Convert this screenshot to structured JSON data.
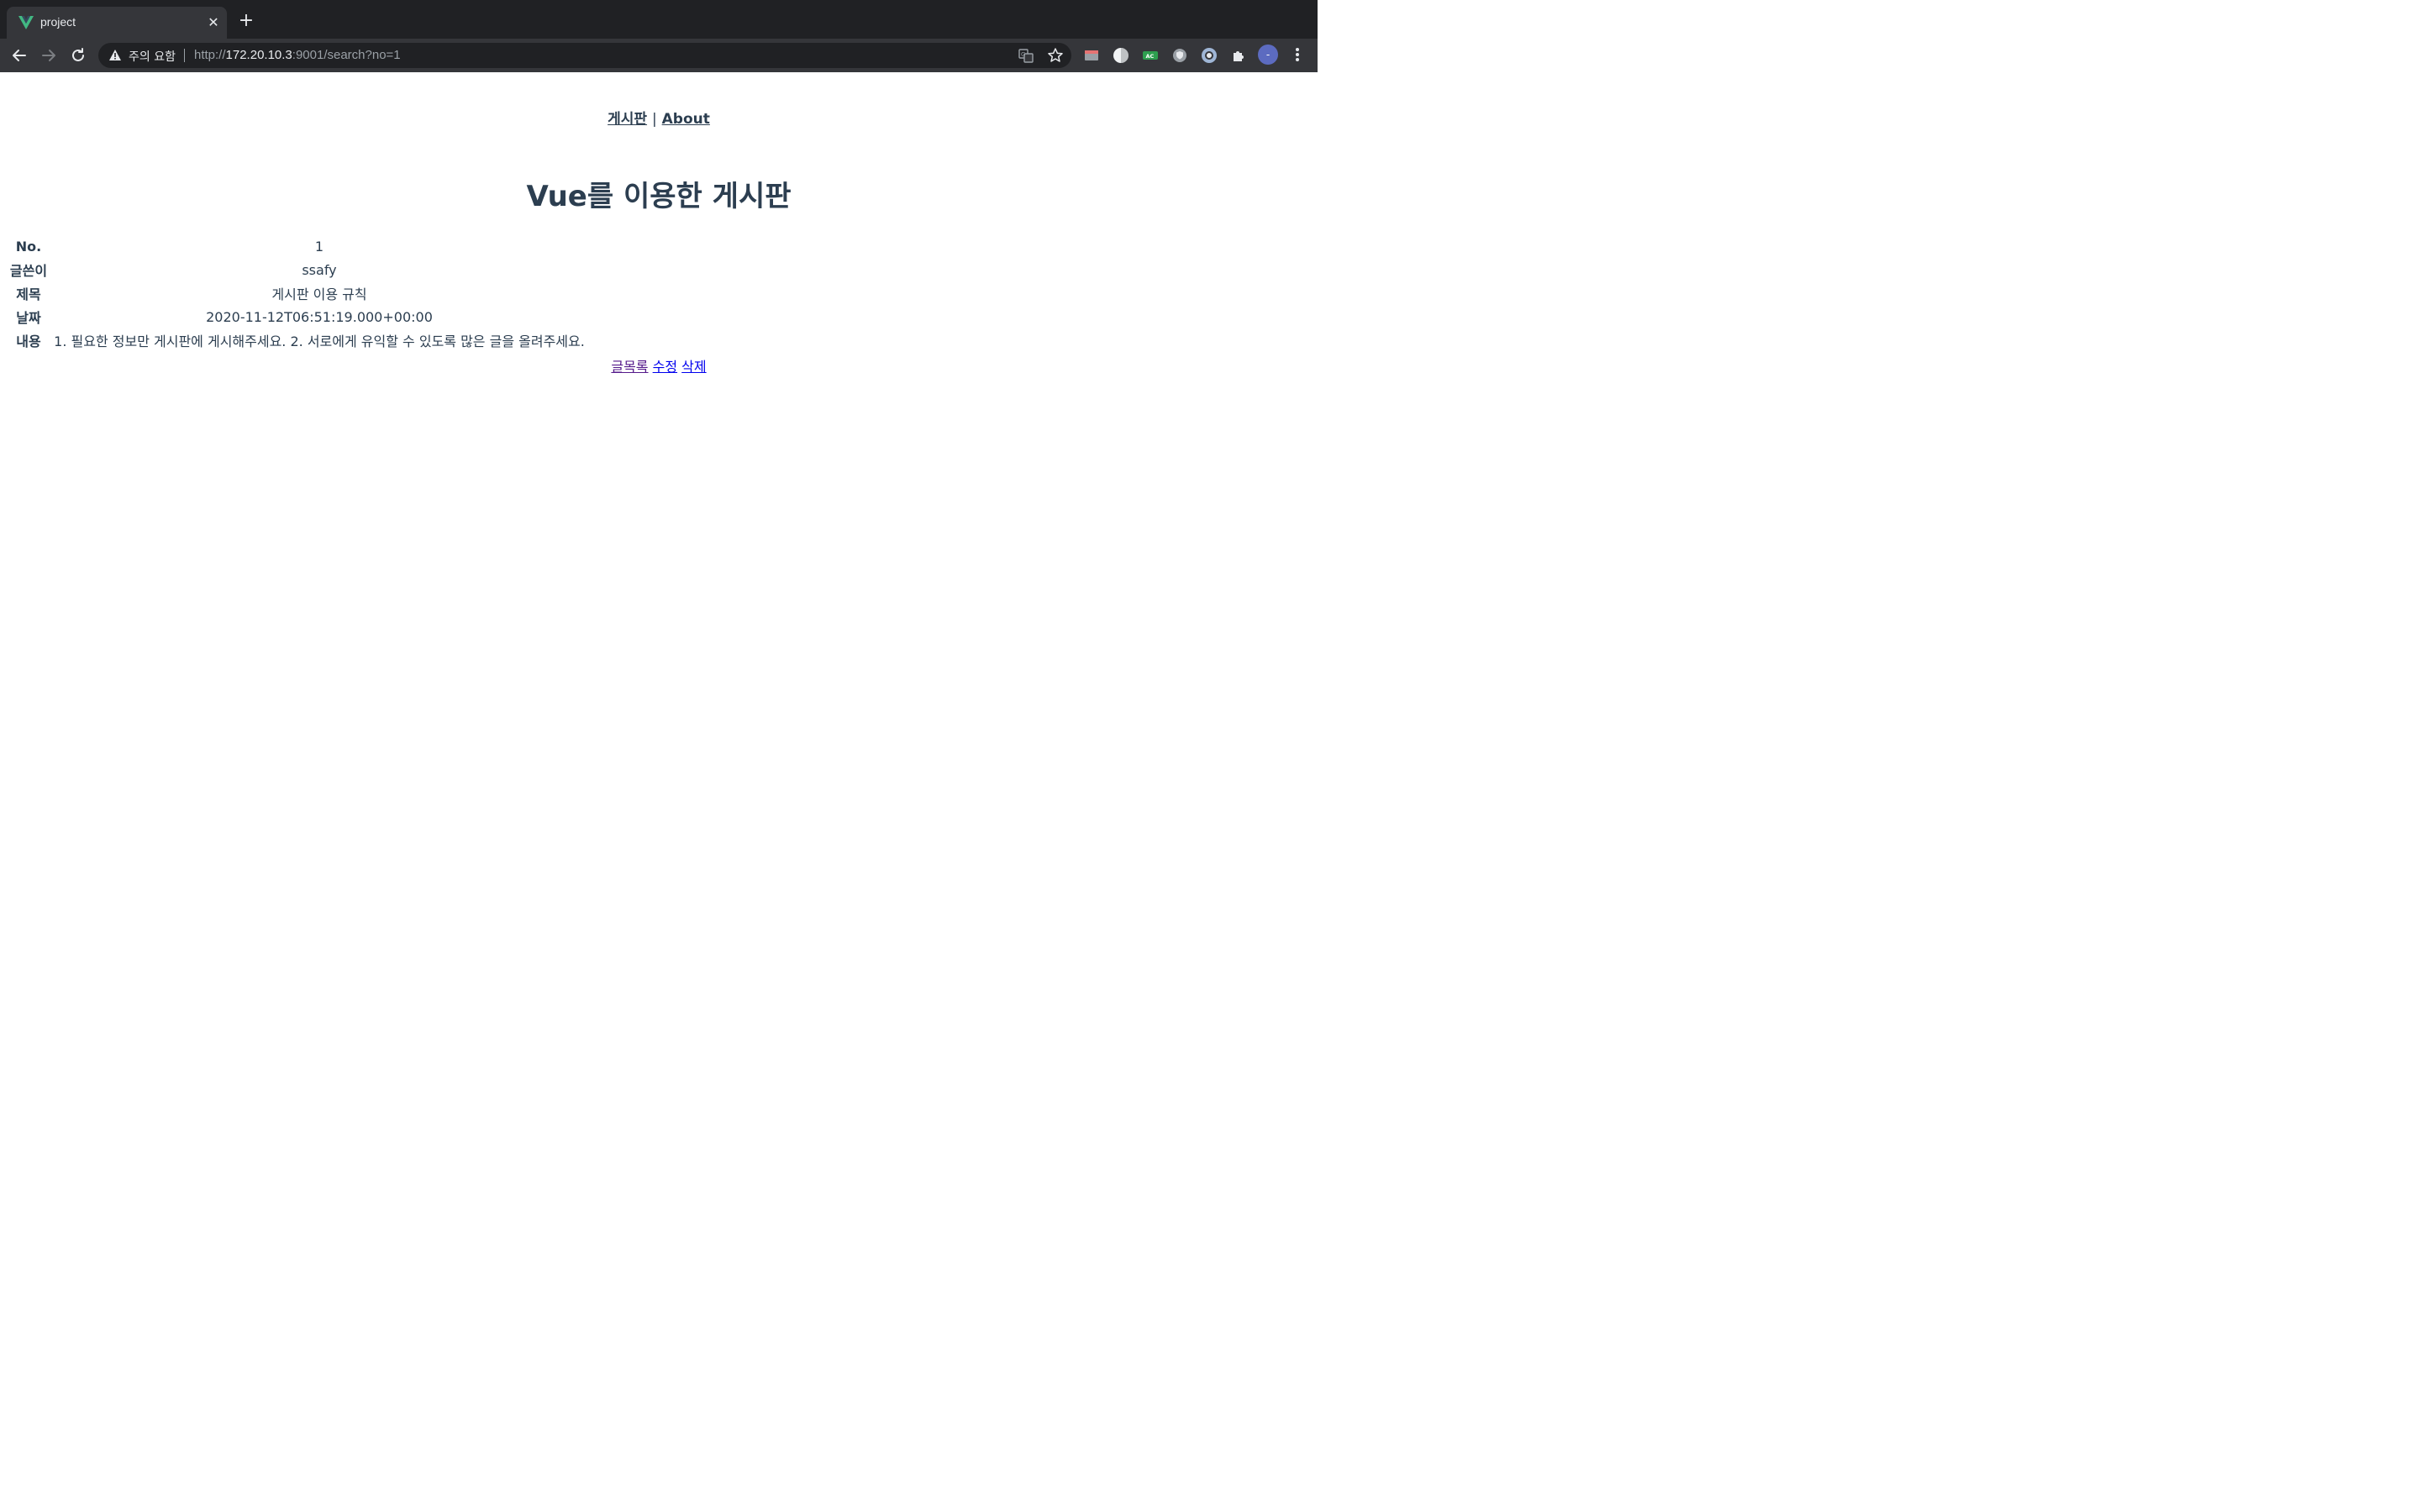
{
  "browser": {
    "tab": {
      "title": "project",
      "favicon": "vue-logo-icon",
      "close_glyph": "✕"
    },
    "new_tab_glyph": "+",
    "omnibox": {
      "security_warning": "주의 요함",
      "url_scheme": "http://",
      "url_host": "172.20.10.3",
      "url_rest": ":9001/search?no=1"
    },
    "profile_initial": "-",
    "accent_vue": "#42b883"
  },
  "nav": {
    "board_link": "게시판",
    "separator": "|",
    "about_link": "About"
  },
  "heading": "Vue를 이용한 게시판",
  "detail": {
    "rows": [
      {
        "label": "No.",
        "value": "1"
      },
      {
        "label": "글쓴이",
        "value": "ssafy"
      },
      {
        "label": "제목",
        "value": "게시판 이용 규칙"
      },
      {
        "label": "날짜",
        "value": "2020-11-12T06:51:19.000+00:00"
      },
      {
        "label": "내용",
        "value": "1. 필요한 정보만 게시판에 게시해주세요. 2. 서로에게 유익할 수 있도록 많은 글을 올려주세요."
      }
    ]
  },
  "actions": {
    "list_label": "글목록",
    "edit_label": "수정",
    "delete_label": "삭제"
  },
  "colors": {
    "text": "#2c3e50",
    "link": "#0000ee",
    "visited_link": "#551a8b"
  }
}
